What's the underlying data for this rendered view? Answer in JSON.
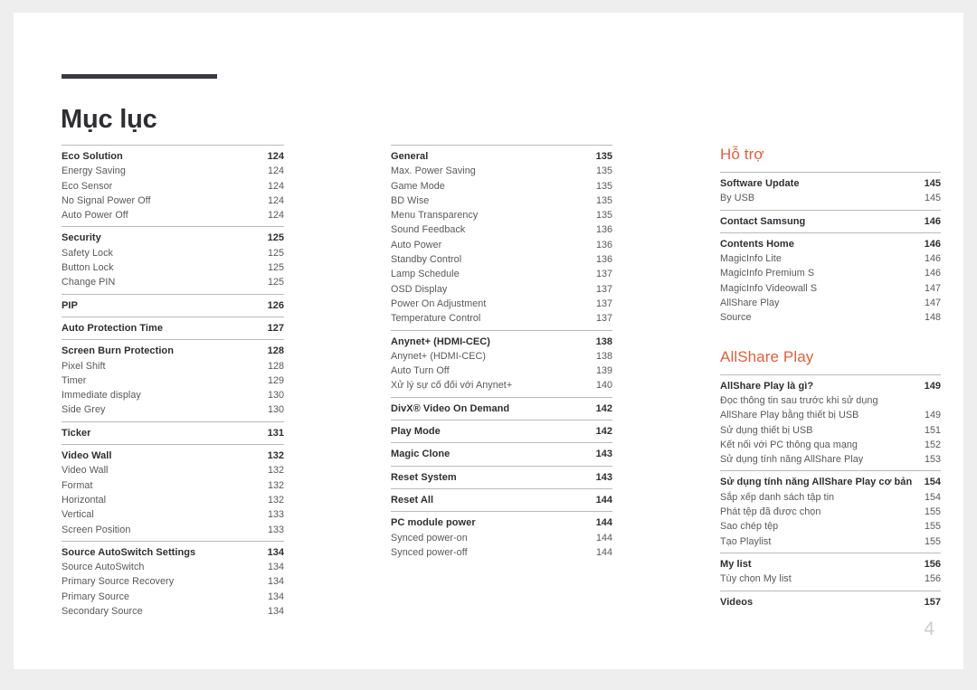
{
  "document": {
    "title": "Mục lục",
    "folio": "4",
    "accent_color": "#e0603a",
    "rule_color": "#3b3a42",
    "text_color": "#58585c",
    "heading_text_color": "#2f2e33",
    "page_background": "#ffffff",
    "canvas_background": "#efeeee"
  },
  "columns": [
    {
      "id": "column-1",
      "section_title": null,
      "groups": [
        {
          "entries": [
            {
              "label": "Eco Solution",
              "page": "124",
              "level": "head"
            },
            {
              "label": "Energy Saving",
              "page": "124",
              "level": "sub"
            },
            {
              "label": "Eco Sensor",
              "page": "124",
              "level": "sub"
            },
            {
              "label": "No Signal Power Off",
              "page": "124",
              "level": "sub"
            },
            {
              "label": "Auto Power Off",
              "page": "124",
              "level": "sub"
            }
          ]
        },
        {
          "entries": [
            {
              "label": "Security",
              "page": "125",
              "level": "head"
            },
            {
              "label": "Safety Lock",
              "page": "125",
              "level": "sub"
            },
            {
              "label": "Button Lock",
              "page": "125",
              "level": "sub"
            },
            {
              "label": "Change PIN",
              "page": "125",
              "level": "sub"
            }
          ]
        },
        {
          "entries": [
            {
              "label": "PIP",
              "page": "126",
              "level": "head"
            }
          ]
        },
        {
          "entries": [
            {
              "label": "Auto Protection Time",
              "page": "127",
              "level": "head"
            }
          ]
        },
        {
          "entries": [
            {
              "label": "Screen Burn Protection",
              "page": "128",
              "level": "head"
            },
            {
              "label": "Pixel Shift",
              "page": "128",
              "level": "sub"
            },
            {
              "label": "Timer",
              "page": "129",
              "level": "sub"
            },
            {
              "label": "Immediate display",
              "page": "130",
              "level": "sub"
            },
            {
              "label": "Side Grey",
              "page": "130",
              "level": "sub"
            }
          ]
        },
        {
          "entries": [
            {
              "label": "Ticker",
              "page": "131",
              "level": "head"
            }
          ]
        },
        {
          "entries": [
            {
              "label": "Video Wall",
              "page": "132",
              "level": "head"
            },
            {
              "label": "Video Wall",
              "page": "132",
              "level": "sub"
            },
            {
              "label": "Format",
              "page": "132",
              "level": "sub"
            },
            {
              "label": "Horizontal",
              "page": "132",
              "level": "sub"
            },
            {
              "label": "Vertical",
              "page": "133",
              "level": "sub"
            },
            {
              "label": "Screen Position",
              "page": "133",
              "level": "sub"
            }
          ]
        },
        {
          "entries": [
            {
              "label": "Source AutoSwitch Settings",
              "page": "134",
              "level": "head"
            },
            {
              "label": "Source AutoSwitch",
              "page": "134",
              "level": "sub"
            },
            {
              "label": "Primary Source Recovery",
              "page": "134",
              "level": "sub"
            },
            {
              "label": "Primary Source",
              "page": "134",
              "level": "sub"
            },
            {
              "label": "Secondary Source",
              "page": "134",
              "level": "sub"
            }
          ]
        }
      ]
    },
    {
      "id": "column-2",
      "section_title": null,
      "groups": [
        {
          "entries": [
            {
              "label": "General",
              "page": "135",
              "level": "head"
            },
            {
              "label": "Max. Power Saving",
              "page": "135",
              "level": "sub"
            },
            {
              "label": "Game Mode",
              "page": "135",
              "level": "sub"
            },
            {
              "label": "BD Wise",
              "page": "135",
              "level": "sub"
            },
            {
              "label": "Menu Transparency",
              "page": "135",
              "level": "sub"
            },
            {
              "label": "Sound Feedback",
              "page": "136",
              "level": "sub"
            },
            {
              "label": "Auto Power",
              "page": "136",
              "level": "sub"
            },
            {
              "label": "Standby Control",
              "page": "136",
              "level": "sub"
            },
            {
              "label": "Lamp Schedule",
              "page": "137",
              "level": "sub"
            },
            {
              "label": "OSD Display",
              "page": "137",
              "level": "sub"
            },
            {
              "label": "Power On Adjustment",
              "page": "137",
              "level": "sub"
            },
            {
              "label": "Temperature Control",
              "page": "137",
              "level": "sub"
            }
          ]
        },
        {
          "entries": [
            {
              "label": "Anynet+ (HDMI-CEC)",
              "page": "138",
              "level": "head"
            },
            {
              "label": "Anynet+ (HDMI-CEC)",
              "page": "138",
              "level": "sub"
            },
            {
              "label": "Auto Turn Off",
              "page": "139",
              "level": "sub"
            },
            {
              "label": "Xử lý sự cố đối với Anynet+",
              "page": "140",
              "level": "sub"
            }
          ]
        },
        {
          "entries": [
            {
              "label": "DivX® Video On Demand",
              "page": "142",
              "level": "head"
            }
          ]
        },
        {
          "entries": [
            {
              "label": "Play Mode",
              "page": "142",
              "level": "head"
            }
          ]
        },
        {
          "entries": [
            {
              "label": "Magic Clone",
              "page": "143",
              "level": "head"
            }
          ]
        },
        {
          "entries": [
            {
              "label": "Reset System",
              "page": "143",
              "level": "head"
            }
          ]
        },
        {
          "entries": [
            {
              "label": "Reset All",
              "page": "144",
              "level": "head"
            }
          ]
        },
        {
          "entries": [
            {
              "label": "PC module power",
              "page": "144",
              "level": "head"
            },
            {
              "label": "Synced power-on",
              "page": "144",
              "level": "sub"
            },
            {
              "label": "Synced power-off",
              "page": "144",
              "level": "sub"
            }
          ]
        }
      ]
    },
    {
      "id": "column-3",
      "sections": [
        {
          "section_title": "Hỗ trợ",
          "groups": [
            {
              "entries": [
                {
                  "label": "Software Update",
                  "page": "145",
                  "level": "head"
                },
                {
                  "label": "By USB",
                  "page": "145",
                  "level": "sub"
                }
              ]
            },
            {
              "entries": [
                {
                  "label": "Contact Samsung",
                  "page": "146",
                  "level": "head"
                }
              ]
            },
            {
              "entries": [
                {
                  "label": "Contents Home",
                  "page": "146",
                  "level": "head"
                },
                {
                  "label": "MagicInfo Lite",
                  "page": "146",
                  "level": "sub"
                },
                {
                  "label": "MagicInfo Premium S",
                  "page": "146",
                  "level": "sub"
                },
                {
                  "label": "MagicInfo Videowall S",
                  "page": "147",
                  "level": "sub"
                },
                {
                  "label": "AllShare Play",
                  "page": "147",
                  "level": "sub"
                },
                {
                  "label": "Source",
                  "page": "148",
                  "level": "sub"
                }
              ]
            }
          ]
        },
        {
          "section_title": "AllShare Play",
          "groups": [
            {
              "entries": [
                {
                  "label": "AllShare Play là gì?",
                  "page": "149",
                  "level": "head"
                },
                {
                  "label": "Đọc thông tin sau trước khi sử dụng",
                  "page": "",
                  "level": "sub"
                },
                {
                  "label": "AllShare Play bằng thiết bị USB",
                  "page": "149",
                  "level": "sub"
                },
                {
                  "label": "Sử dụng thiết bị USB",
                  "page": "151",
                  "level": "sub"
                },
                {
                  "label": "Kết nối với PC thông qua mạng",
                  "page": "152",
                  "level": "sub"
                },
                {
                  "label": "Sử dụng tính năng AllShare Play",
                  "page": "153",
                  "level": "sub"
                }
              ]
            },
            {
              "entries": [
                {
                  "label": "Sử dụng tính năng AllShare Play cơ bản",
                  "page": "154",
                  "level": "head"
                },
                {
                  "label": "Sắp xếp danh sách tập tin",
                  "page": "154",
                  "level": "sub"
                },
                {
                  "label": "Phát tệp đã được chọn",
                  "page": "155",
                  "level": "sub"
                },
                {
                  "label": "Sao chép tệp",
                  "page": "155",
                  "level": "sub"
                },
                {
                  "label": "Tạo Playlist",
                  "page": "155",
                  "level": "sub"
                }
              ]
            },
            {
              "entries": [
                {
                  "label": "My list",
                  "page": "156",
                  "level": "head"
                },
                {
                  "label": "Tùy chọn My list",
                  "page": "156",
                  "level": "sub"
                }
              ]
            },
            {
              "entries": [
                {
                  "label": "Videos",
                  "page": "157",
                  "level": "head"
                }
              ]
            }
          ]
        }
      ]
    }
  ]
}
